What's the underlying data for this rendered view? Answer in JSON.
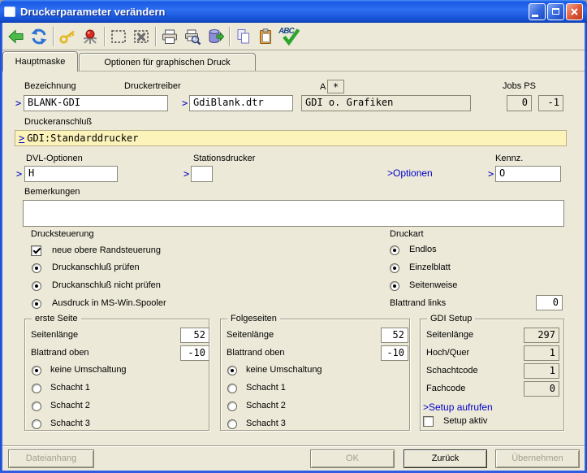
{
  "window": {
    "title": "Druckerparameter verändern"
  },
  "titlebar": {
    "buttons": [
      "minimize",
      "maximize",
      "close"
    ]
  },
  "toolbar": {
    "icons": [
      "back",
      "refresh",
      "key",
      "pin",
      "select-region",
      "clear-selection",
      "print",
      "print-preview",
      "export-data",
      "copy",
      "paste",
      "spellcheck"
    ],
    "spellcheck_label": "ABC"
  },
  "tabs": [
    {
      "label": "Hauptmaske",
      "active": true
    },
    {
      "label": "Optionen für graphischen Druck",
      "active": false
    }
  ],
  "form": {
    "bezeichnung": {
      "label": "Bezeichnung",
      "prompt": ">",
      "value": "BLANK-GDI"
    },
    "druckertreiber": {
      "label": "Druckertreiber",
      "prompt": ">",
      "value": "GdiBlank.dtr"
    },
    "a_kennzeichen": {
      "label": "A",
      "value": "*"
    },
    "treiber_beschreibung": {
      "value": "GDI o. Grafiken"
    },
    "jobs_ps": {
      "label": "Jobs PS",
      "jobs": "0",
      "ps": "-1"
    },
    "druckeranschluss": {
      "label": "Druckeranschluß",
      "prompt": ">",
      "value": "GDI:Standarddrucker"
    },
    "dvl_optionen": {
      "label": "DVL-Optionen",
      "prompt": ">",
      "value": "H"
    },
    "stationsdrucker": {
      "label": "Stationsdrucker",
      "prompt": ">",
      "value": ""
    },
    "optionen_link": {
      "label": ">Optionen"
    },
    "kennz": {
      "label": "Kennz.",
      "prompt": ">",
      "value": "O"
    },
    "bemerkungen": {
      "label": "Bemerkungen",
      "value": ""
    }
  },
  "drucksteuerung": {
    "title": "Drucksteuerung",
    "neue_randsteuerung": {
      "label": "neue obere Randsteuerung",
      "checked": true
    },
    "radios": [
      {
        "label": "Druckanschluß prüfen",
        "selected": true
      },
      {
        "label": "Druckanschluß nicht prüfen",
        "selected": true
      },
      {
        "label": "Ausdruck in MS-Win.Spooler",
        "selected": true
      }
    ]
  },
  "druckart": {
    "title": "Druckart",
    "radios": [
      {
        "label": "Endlos",
        "selected": true
      },
      {
        "label": "Einzelblatt",
        "selected": true
      },
      {
        "label": "Seitenweise",
        "selected": true
      }
    ],
    "blattrand_links": {
      "label": "Blattrand links",
      "value": "0"
    }
  },
  "erste_seite": {
    "title": "erste Seite",
    "seitenlaenge": {
      "label": "Seitenlänge",
      "value": "52"
    },
    "blattrand_oben": {
      "label": "Blattrand oben",
      "value": "-10"
    },
    "radios": [
      {
        "label": "keine Umschaltung",
        "selected": true
      },
      {
        "label": "Schacht 1",
        "selected": false
      },
      {
        "label": "Schacht 2",
        "selected": false
      },
      {
        "label": "Schacht 3",
        "selected": false
      }
    ]
  },
  "folgeseiten": {
    "title": "Folgeseiten",
    "seitenlaenge": {
      "label": "Seitenlänge",
      "value": "52"
    },
    "blattrand_oben": {
      "label": "Blattrand oben",
      "value": "-10"
    },
    "radios": [
      {
        "label": "keine Umschaltung",
        "selected": true
      },
      {
        "label": "Schacht 1",
        "selected": false
      },
      {
        "label": "Schacht 2",
        "selected": false
      },
      {
        "label": "Schacht 3",
        "selected": false
      }
    ]
  },
  "gdi_setup": {
    "title": "GDI Setup",
    "seitenlaenge": {
      "label": "Seitenlänge",
      "value": "297"
    },
    "hoch_quer": {
      "label": "Hoch/Quer",
      "value": "1"
    },
    "schachtcode": {
      "label": "Schachtcode",
      "value": "1"
    },
    "fachcode": {
      "label": "Fachcode",
      "value": "0"
    },
    "setup_link": {
      "label": ">Setup aufrufen"
    },
    "setup_aktiv": {
      "label": "Setup aktiv",
      "checked": false
    }
  },
  "footer": {
    "buttons": [
      {
        "label": "Dateianhang",
        "enabled": false
      },
      {
        "label": "OK",
        "enabled": false
      },
      {
        "label": "Zurück",
        "enabled": true
      },
      {
        "label": "Übernehmen",
        "enabled": false
      }
    ]
  },
  "colors": {
    "dialog_bg": "#ECE9D8",
    "titlebar_blue": "#2E6EF2",
    "frame_blue": "#2E5CE4",
    "highlight_yellow": "#FBF3B9",
    "link_blue": "#0000C8"
  }
}
